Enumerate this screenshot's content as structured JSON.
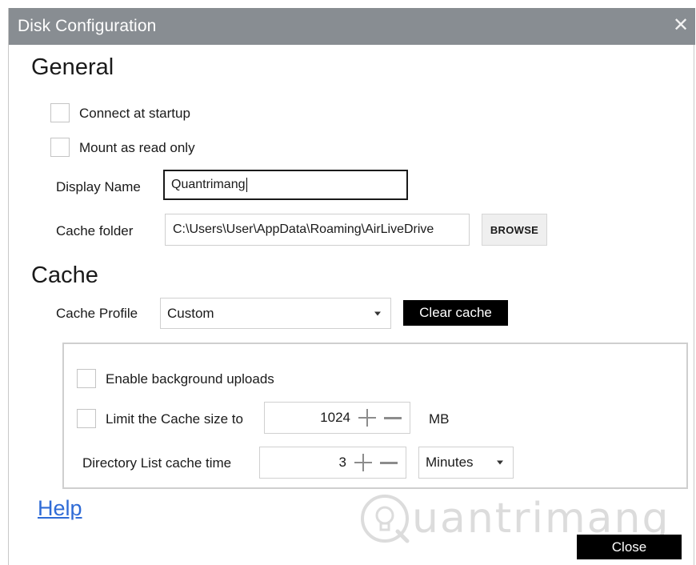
{
  "window": {
    "title": "Disk Configuration",
    "close_glyph": "✕"
  },
  "general": {
    "heading": "General",
    "connect_at_startup": {
      "label": "Connect at startup",
      "checked": false
    },
    "mount_read_only": {
      "label": "Mount as read only",
      "checked": false
    },
    "display_name": {
      "label": "Display Name",
      "value": "Quantrimang"
    },
    "cache_folder": {
      "label": "Cache folder",
      "value": "C:\\Users\\User\\AppData\\Roaming\\AirLiveDrive",
      "browse_label": "BROWSE"
    }
  },
  "cache": {
    "heading": "Cache",
    "profile": {
      "label": "Cache Profile",
      "value": "Custom"
    },
    "clear_label": "Clear cache",
    "background_uploads": {
      "label": "Enable background uploads",
      "checked": false
    },
    "limit_size": {
      "label": "Limit the Cache size to",
      "value": "1024",
      "unit": "MB",
      "checked": false
    },
    "dir_list": {
      "label": "Directory List cache time",
      "value": "3",
      "unit": "Minutes"
    }
  },
  "footer": {
    "help_label": "Help",
    "close_label": "Close"
  },
  "watermark": {
    "text": "uantrimang"
  },
  "icons": {
    "close": "close-icon",
    "dropdown": "chevron-down-icon",
    "plus": "plus-icon",
    "minus": "minus-icon",
    "watermark_logo": "lightbulb-icon"
  },
  "colors": {
    "titlebar": "#888d92",
    "link": "#2f6bd6",
    "dark_button": "#000000"
  }
}
